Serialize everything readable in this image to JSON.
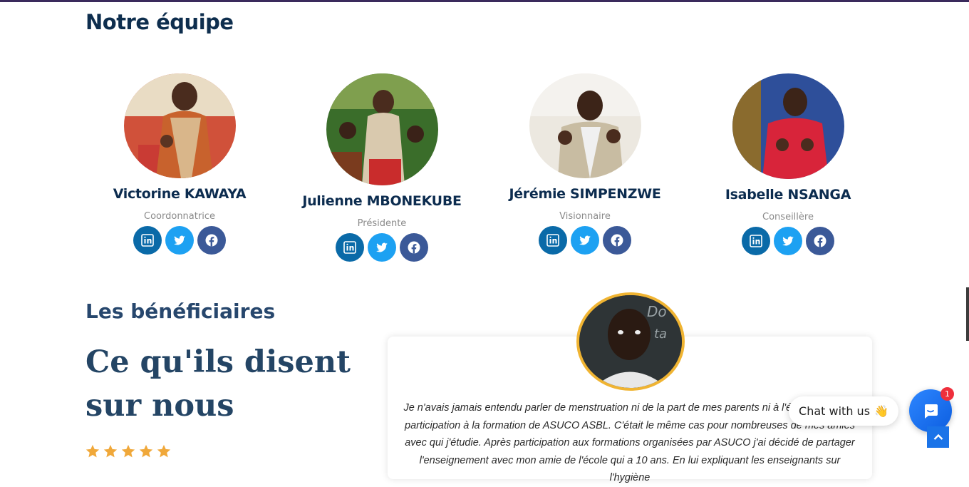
{
  "team": {
    "title": "Notre équipe",
    "members": [
      {
        "name": "Victorine KAWAYA",
        "role": "Coordonnatrice"
      },
      {
        "name": "Julienne MBONEKUBE",
        "role": "Présidente"
      },
      {
        "name": "Jérémie SIMPENZWE",
        "role": "Visionnaire"
      },
      {
        "name": "Isabelle NSANGA",
        "role": "Conseillère"
      }
    ],
    "social_icons": [
      "linkedin-icon",
      "twitter-icon",
      "facebook-icon"
    ]
  },
  "beneficiaries": {
    "subtitle": "Les bénéficiaires",
    "title": "Ce qu'ils disent sur nous",
    "rating": 5,
    "testimonial": "Je n'avais jamais entendu parler de menstruation ni de la part de mes parents ni à l'école avant ma participation à la formation de ASUCO ASBL. C'était le même cas pour nombreuses de mes amies avec qui j'étudie. Après participation aux formations organisées par ASUCO j'ai décidé de partager l'enseignement avec mon amie de l'école qui a 10 ans. En lui expliquant les enseignants sur l'hygiène"
  },
  "chat": {
    "label": "Chat with us",
    "emoji": "👋",
    "badge": "1"
  },
  "colors": {
    "heading": "#0e2e4e",
    "linkedin": "#0a6aa8",
    "twitter": "#1da1f2",
    "facebook": "#3b5998",
    "star": "#f0a83a",
    "photo_border": "#f0b432",
    "chat_blue": "#1a73e8"
  }
}
